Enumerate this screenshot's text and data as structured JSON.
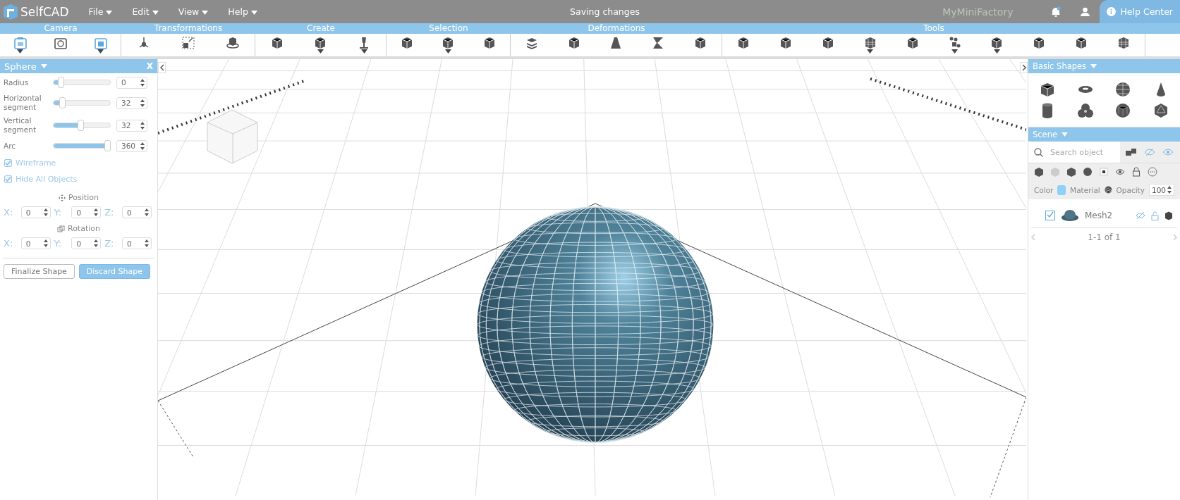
{
  "app": {
    "name": "SelfCAD",
    "menus": [
      "File",
      "Edit",
      "View",
      "Help"
    ],
    "status": "Saving changes",
    "partner": "MyMiniFactory",
    "help": "Help Center"
  },
  "toolbar": [
    {
      "label": "Camera",
      "tools": [
        {
          "kind": "camera360",
          "dropdown": true
        },
        {
          "kind": "rotate",
          "dropdown": false
        },
        {
          "kind": "frame",
          "dropdown": true
        }
      ]
    },
    {
      "label": "Transformations",
      "tools": [
        {
          "kind": "move",
          "dropdown": false
        },
        {
          "kind": "scale",
          "dropdown": false
        },
        {
          "kind": "spin",
          "dropdown": false
        }
      ]
    },
    {
      "label": "Create",
      "tools": [
        {
          "kind": "cube",
          "dropdown": false
        },
        {
          "kind": "cube",
          "dropdown": true
        },
        {
          "kind": "pin",
          "dropdown": true
        }
      ]
    },
    {
      "label": "Selection",
      "tools": [
        {
          "kind": "cube",
          "dropdown": false
        },
        {
          "kind": "cube",
          "dropdown": true
        },
        {
          "kind": "cube",
          "dropdown": false
        }
      ]
    },
    {
      "label": "Deformations",
      "tools": [
        {
          "kind": "stack",
          "dropdown": false
        },
        {
          "kind": "cube",
          "dropdown": false
        },
        {
          "kind": "cone",
          "dropdown": false
        },
        {
          "kind": "twist",
          "dropdown": false
        },
        {
          "kind": "cube",
          "dropdown": false
        }
      ]
    },
    {
      "label": "Tools",
      "tools": [
        {
          "kind": "cube",
          "dropdown": false
        },
        {
          "kind": "cube",
          "dropdown": false
        },
        {
          "kind": "cube",
          "dropdown": false
        },
        {
          "kind": "grid",
          "dropdown": true
        },
        {
          "kind": "cube",
          "dropdown": false
        },
        {
          "kind": "dots",
          "dropdown": true
        },
        {
          "kind": "cube",
          "dropdown": true
        },
        {
          "kind": "cube",
          "dropdown": false
        },
        {
          "kind": "cube",
          "dropdown": false
        },
        {
          "kind": "grid",
          "dropdown": false
        }
      ]
    }
  ],
  "shape_panel": {
    "title": "Sphere",
    "close": "X",
    "params": [
      {
        "label": "Radius",
        "level": 0.1,
        "value": "0"
      },
      {
        "label": "Horizontal segment",
        "level": 0.12,
        "value": "32"
      },
      {
        "label": "Vertical segment",
        "level": 0.48,
        "value": "32"
      },
      {
        "label": "Arc",
        "level": 1.0,
        "value": "360"
      }
    ],
    "options": [
      {
        "label": "Wireframe",
        "checked": true
      },
      {
        "label": "Hide All Objects",
        "checked": true
      }
    ],
    "groups": [
      {
        "title": "Position",
        "kind": "move",
        "axes": [
          {
            "axis": "X:",
            "value": "0"
          },
          {
            "axis": "Y:",
            "value": "0"
          },
          {
            "axis": "Z:",
            "value": "0"
          }
        ]
      },
      {
        "title": "Rotation",
        "kind": "rotate",
        "axes": [
          {
            "axis": "X:",
            "value": "0"
          },
          {
            "axis": "Y:",
            "value": "0"
          },
          {
            "axis": "Z:",
            "value": "0"
          }
        ]
      }
    ],
    "buttons": [
      {
        "label": "Finalize Shape",
        "kind": "secondary"
      },
      {
        "label": "Discard Shape",
        "kind": "primary"
      }
    ]
  },
  "basic_shapes": {
    "title": "Basic Shapes"
  },
  "scene": {
    "title": "Scene",
    "search": {
      "placeholder": "Search object"
    },
    "props": {
      "color_label": "Color",
      "color": "#8fd0f7",
      "material_label": "Material",
      "opacity_label": "Opacity",
      "opacity": "100"
    },
    "objects": [
      {
        "name": "Mesh2",
        "checked": true
      }
    ],
    "pagination": "1-1 of 1"
  }
}
